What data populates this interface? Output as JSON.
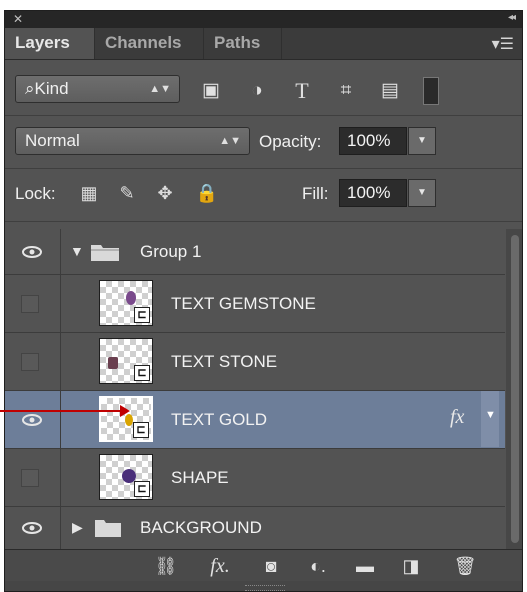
{
  "titlebar": {
    "close": "✕",
    "collapse": "◂◂"
  },
  "tabs": [
    "Layers",
    "Channels",
    "Paths"
  ],
  "panel_menu_icon": "hamburger-menu-icon",
  "filter": {
    "label": "Kind",
    "icons": [
      "image-filter-icon",
      "adjustment-filter-icon",
      "type-filter-icon",
      "shape-filter-icon",
      "smartobject-filter-icon",
      "filter-toggle-icon"
    ]
  },
  "blend": {
    "mode": "Normal",
    "opacity_label": "Opacity:",
    "opacity": "100%"
  },
  "lock": {
    "label": "Lock:",
    "icons": [
      "lock-transparent-icon",
      "lock-pixels-icon",
      "lock-position-icon",
      "lock-all-icon"
    ],
    "fill_label": "Fill:",
    "fill": "100%"
  },
  "layers": [
    {
      "name": "Group 1",
      "type": "group",
      "visible": true
    },
    {
      "name": "TEXT GEMSTONE",
      "type": "smart",
      "visible": false
    },
    {
      "name": "TEXT STONE",
      "type": "smart",
      "visible": false
    },
    {
      "name": "TEXT GOLD",
      "type": "smart",
      "visible": true,
      "selected": true,
      "fx": "fx"
    },
    {
      "name": "SHAPE",
      "type": "smart",
      "visible": false
    },
    {
      "name": "BACKGROUND",
      "type": "group",
      "visible": true
    }
  ],
  "bottom_icons": [
    "link-layers-icon",
    "add-style-icon",
    "add-mask-icon",
    "new-adjustment-icon",
    "new-group-icon",
    "new-layer-icon",
    "delete-layer-icon"
  ],
  "colors": {
    "panel": "#535353",
    "selected_row": "#6d7e99",
    "arrow": "#c00000"
  }
}
